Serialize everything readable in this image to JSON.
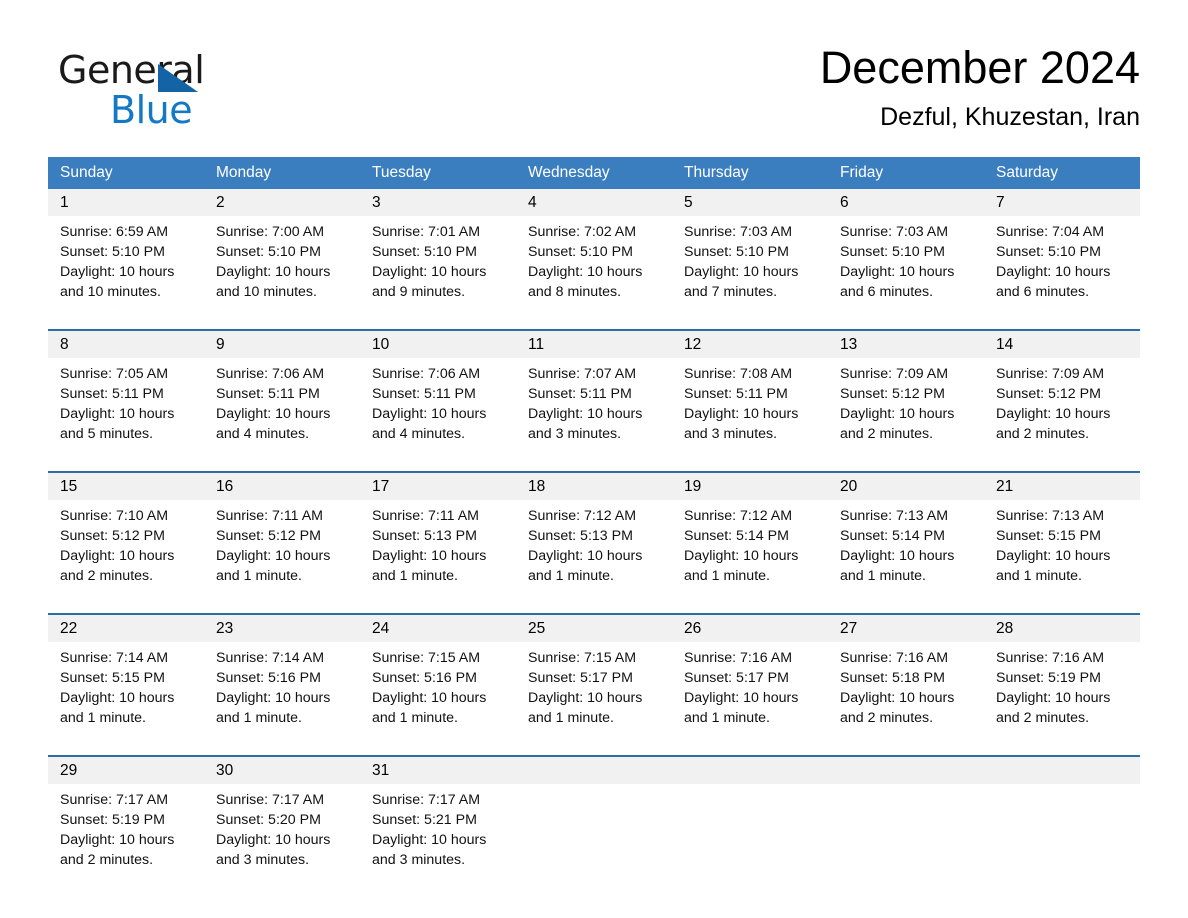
{
  "brand": {
    "word_one": "General",
    "word_two": "Blue",
    "triangle_color": "#1464a5",
    "blue_color": "#1479c4"
  },
  "header": {
    "month_title": "December 2024",
    "location": "Dezful, Khuzestan, Iran"
  },
  "calendar": {
    "header_bg": "#3a7ebf",
    "row_divider": "#2e6da4",
    "datenum_bg": "#f1f1f1",
    "weekdays": [
      "Sunday",
      "Monday",
      "Tuesday",
      "Wednesday",
      "Thursday",
      "Friday",
      "Saturday"
    ],
    "weeks": [
      [
        {
          "day": "1",
          "lines": [
            "Sunrise: 6:59 AM",
            "Sunset: 5:10 PM",
            "Daylight: 10 hours",
            "and 10 minutes."
          ]
        },
        {
          "day": "2",
          "lines": [
            "Sunrise: 7:00 AM",
            "Sunset: 5:10 PM",
            "Daylight: 10 hours",
            "and 10 minutes."
          ]
        },
        {
          "day": "3",
          "lines": [
            "Sunrise: 7:01 AM",
            "Sunset: 5:10 PM",
            "Daylight: 10 hours",
            "and 9 minutes."
          ]
        },
        {
          "day": "4",
          "lines": [
            "Sunrise: 7:02 AM",
            "Sunset: 5:10 PM",
            "Daylight: 10 hours",
            "and 8 minutes."
          ]
        },
        {
          "day": "5",
          "lines": [
            "Sunrise: 7:03 AM",
            "Sunset: 5:10 PM",
            "Daylight: 10 hours",
            "and 7 minutes."
          ]
        },
        {
          "day": "6",
          "lines": [
            "Sunrise: 7:03 AM",
            "Sunset: 5:10 PM",
            "Daylight: 10 hours",
            "and 6 minutes."
          ]
        },
        {
          "day": "7",
          "lines": [
            "Sunrise: 7:04 AM",
            "Sunset: 5:10 PM",
            "Daylight: 10 hours",
            "and 6 minutes."
          ]
        }
      ],
      [
        {
          "day": "8",
          "lines": [
            "Sunrise: 7:05 AM",
            "Sunset: 5:11 PM",
            "Daylight: 10 hours",
            "and 5 minutes."
          ]
        },
        {
          "day": "9",
          "lines": [
            "Sunrise: 7:06 AM",
            "Sunset: 5:11 PM",
            "Daylight: 10 hours",
            "and 4 minutes."
          ]
        },
        {
          "day": "10",
          "lines": [
            "Sunrise: 7:06 AM",
            "Sunset: 5:11 PM",
            "Daylight: 10 hours",
            "and 4 minutes."
          ]
        },
        {
          "day": "11",
          "lines": [
            "Sunrise: 7:07 AM",
            "Sunset: 5:11 PM",
            "Daylight: 10 hours",
            "and 3 minutes."
          ]
        },
        {
          "day": "12",
          "lines": [
            "Sunrise: 7:08 AM",
            "Sunset: 5:11 PM",
            "Daylight: 10 hours",
            "and 3 minutes."
          ]
        },
        {
          "day": "13",
          "lines": [
            "Sunrise: 7:09 AM",
            "Sunset: 5:12 PM",
            "Daylight: 10 hours",
            "and 2 minutes."
          ]
        },
        {
          "day": "14",
          "lines": [
            "Sunrise: 7:09 AM",
            "Sunset: 5:12 PM",
            "Daylight: 10 hours",
            "and 2 minutes."
          ]
        }
      ],
      [
        {
          "day": "15",
          "lines": [
            "Sunrise: 7:10 AM",
            "Sunset: 5:12 PM",
            "Daylight: 10 hours",
            "and 2 minutes."
          ]
        },
        {
          "day": "16",
          "lines": [
            "Sunrise: 7:11 AM",
            "Sunset: 5:12 PM",
            "Daylight: 10 hours",
            "and 1 minute."
          ]
        },
        {
          "day": "17",
          "lines": [
            "Sunrise: 7:11 AM",
            "Sunset: 5:13 PM",
            "Daylight: 10 hours",
            "and 1 minute."
          ]
        },
        {
          "day": "18",
          "lines": [
            "Sunrise: 7:12 AM",
            "Sunset: 5:13 PM",
            "Daylight: 10 hours",
            "and 1 minute."
          ]
        },
        {
          "day": "19",
          "lines": [
            "Sunrise: 7:12 AM",
            "Sunset: 5:14 PM",
            "Daylight: 10 hours",
            "and 1 minute."
          ]
        },
        {
          "day": "20",
          "lines": [
            "Sunrise: 7:13 AM",
            "Sunset: 5:14 PM",
            "Daylight: 10 hours",
            "and 1 minute."
          ]
        },
        {
          "day": "21",
          "lines": [
            "Sunrise: 7:13 AM",
            "Sunset: 5:15 PM",
            "Daylight: 10 hours",
            "and 1 minute."
          ]
        }
      ],
      [
        {
          "day": "22",
          "lines": [
            "Sunrise: 7:14 AM",
            "Sunset: 5:15 PM",
            "Daylight: 10 hours",
            "and 1 minute."
          ]
        },
        {
          "day": "23",
          "lines": [
            "Sunrise: 7:14 AM",
            "Sunset: 5:16 PM",
            "Daylight: 10 hours",
            "and 1 minute."
          ]
        },
        {
          "day": "24",
          "lines": [
            "Sunrise: 7:15 AM",
            "Sunset: 5:16 PM",
            "Daylight: 10 hours",
            "and 1 minute."
          ]
        },
        {
          "day": "25",
          "lines": [
            "Sunrise: 7:15 AM",
            "Sunset: 5:17 PM",
            "Daylight: 10 hours",
            "and 1 minute."
          ]
        },
        {
          "day": "26",
          "lines": [
            "Sunrise: 7:16 AM",
            "Sunset: 5:17 PM",
            "Daylight: 10 hours",
            "and 1 minute."
          ]
        },
        {
          "day": "27",
          "lines": [
            "Sunrise: 7:16 AM",
            "Sunset: 5:18 PM",
            "Daylight: 10 hours",
            "and 2 minutes."
          ]
        },
        {
          "day": "28",
          "lines": [
            "Sunrise: 7:16 AM",
            "Sunset: 5:19 PM",
            "Daylight: 10 hours",
            "and 2 minutes."
          ]
        }
      ],
      [
        {
          "day": "29",
          "lines": [
            "Sunrise: 7:17 AM",
            "Sunset: 5:19 PM",
            "Daylight: 10 hours",
            "and 2 minutes."
          ]
        },
        {
          "day": "30",
          "lines": [
            "Sunrise: 7:17 AM",
            "Sunset: 5:20 PM",
            "Daylight: 10 hours",
            "and 3 minutes."
          ]
        },
        {
          "day": "31",
          "lines": [
            "Sunrise: 7:17 AM",
            "Sunset: 5:21 PM",
            "Daylight: 10 hours",
            "and 3 minutes."
          ]
        },
        {
          "day": "",
          "lines": []
        },
        {
          "day": "",
          "lines": []
        },
        {
          "day": "",
          "lines": []
        },
        {
          "day": "",
          "lines": []
        }
      ]
    ]
  }
}
